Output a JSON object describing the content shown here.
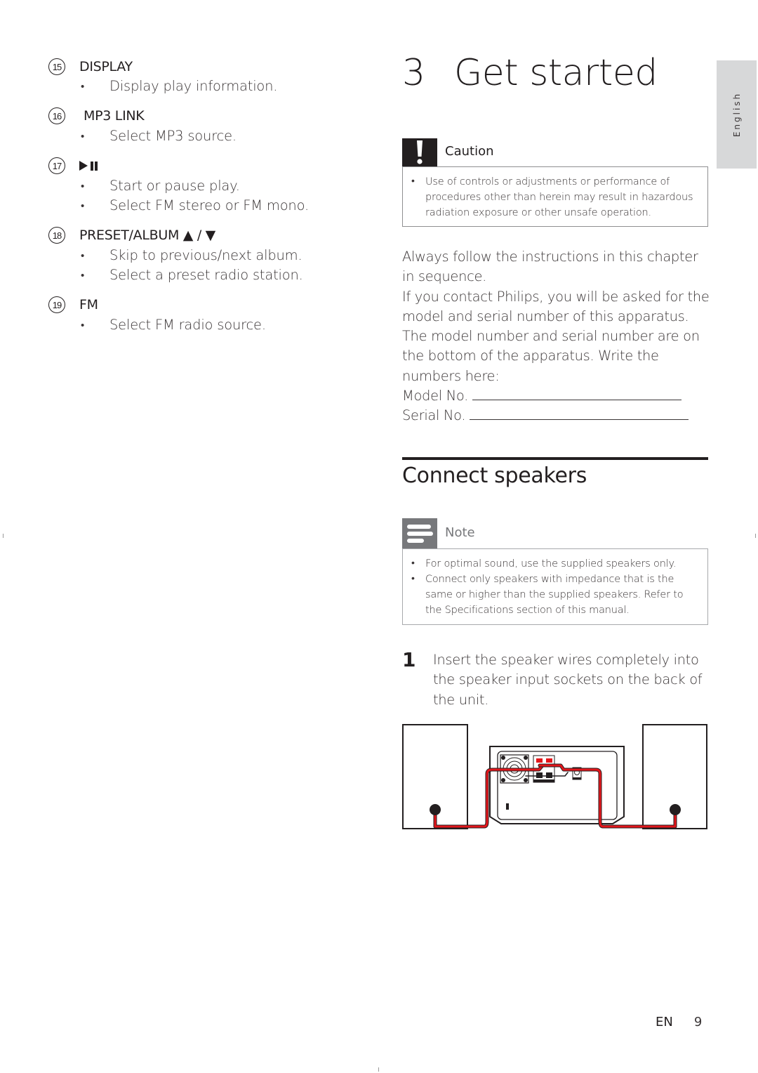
{
  "left_column": {
    "items": [
      {
        "number": "15",
        "title": "DISPLAY",
        "bullets": [
          "Display play information."
        ]
      },
      {
        "number": "16",
        "title": "MP3 LINK",
        "bullets": [
          "Select MP3 source."
        ]
      },
      {
        "number": "17",
        "title_icon": "play-pause-icon",
        "bullets": [
          "Start or pause play.",
          "Select FM stereo or FM mono."
        ]
      },
      {
        "number": "18",
        "title": "PRESET/ALBUM ▲ / ▼",
        "bullets": [
          "Skip to previous/next album.",
          "Select a preset radio station."
        ]
      },
      {
        "number": "19",
        "title": "FM",
        "bullets": [
          "Select FM radio source."
        ]
      }
    ]
  },
  "chapter": {
    "number": "3",
    "title": "Get started"
  },
  "language_tab": "English",
  "caution": {
    "icon": "exclamation-icon",
    "label": "Caution",
    "bullets": [
      "Use of controls or adjustments or performance of procedures other than herein may result in hazardous radiation exposure or other unsafe operation."
    ]
  },
  "intro": {
    "p1": "Always follow the instructions in this chapter in sequence.",
    "p2": "If you contact Philips, you will be asked for the model and serial number of this apparatus. The model number and serial number are on the bottom of the apparatus. Write the numbers here:",
    "model_label": "Model No.",
    "serial_label": "Serial No."
  },
  "section": {
    "title": "Connect speakers"
  },
  "note": {
    "icon": "note-lines-icon",
    "label": "Note",
    "bullets": [
      "For optimal sound, use the supplied speakers only.",
      "Connect only speakers with impedance that is the same or higher than the supplied speakers. Refer to the Specifications section of this manual."
    ]
  },
  "steps": [
    {
      "number": "1",
      "text": "Insert the speaker wires completely into the speaker input sockets on the back of the unit."
    }
  ],
  "figure": {
    "description": "speaker-connection-diagram",
    "wire_color": "#e3161b"
  },
  "footer": {
    "lang": "EN",
    "page": "9"
  }
}
